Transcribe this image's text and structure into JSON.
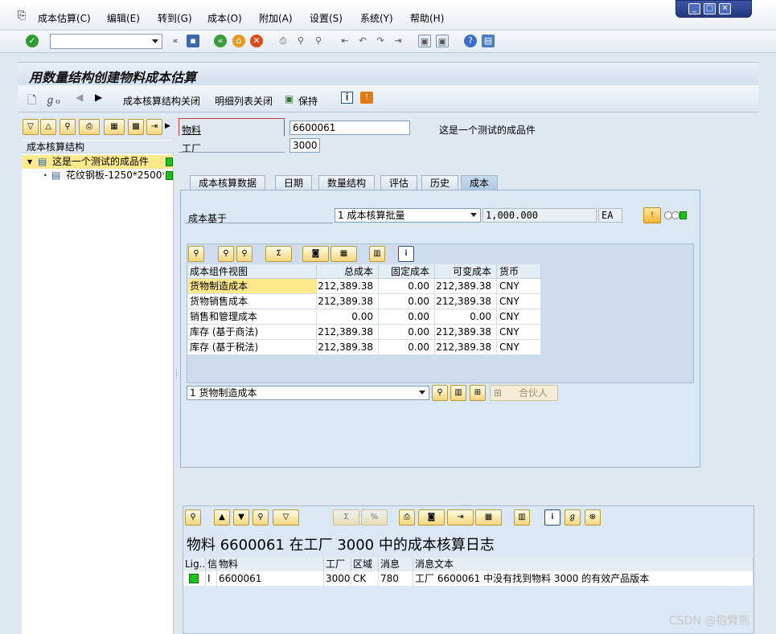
{
  "menu": [
    "成本估算(C)",
    "编辑(E)",
    "转到(G)",
    "成本(O)",
    "附加(A)",
    "设置(S)",
    "系统(Y)",
    "帮助(H)"
  ],
  "title": "用数量结构创建物料成本估算",
  "app_toolbar": {
    "btn1": "成本核算结构关闭",
    "btn2": "明细列表关闭",
    "btn3": "保持"
  },
  "tree": {
    "header": "成本核算结构",
    "root": "这是一个测试的成品件",
    "child": "花纹钢板-1250*2500*"
  },
  "fields": {
    "material_label": "物料",
    "material_value": "6600061",
    "material_desc": "这是一个测试的成品件",
    "plant_label": "工厂",
    "plant_value": "3000"
  },
  "tabs": [
    "成本核算数据",
    "日期",
    "数量结构",
    "评估",
    "历史",
    "成本"
  ],
  "cost_basis": {
    "label": "成本基于",
    "select": "1 成本核算批量",
    "qty": "1,000.000",
    "unit": "EA"
  },
  "grid": {
    "headers": [
      "成本组件视图",
      "总成本",
      "固定成本",
      "可变成本",
      "货币"
    ],
    "rows": [
      [
        "货物制造成本",
        "212,389.38",
        "0.00",
        "212,389.38",
        "CNY"
      ],
      [
        "货物销售成本",
        "212,389.38",
        "0.00",
        "212,389.38",
        "CNY"
      ],
      [
        "销售和管理成本",
        "0.00",
        "0.00",
        "0.00",
        "CNY"
      ],
      [
        "库存 (基于商法)",
        "212,389.38",
        "0.00",
        "212,389.38",
        "CNY"
      ],
      [
        "库存 (基于税法)",
        "212,389.38",
        "0.00",
        "212,389.38",
        "CNY"
      ]
    ]
  },
  "bottom_select": "1 货物制造成本",
  "partner_button": "合伙人",
  "log": {
    "title": "物料 6600061 在工厂 3000 中的成本核算日志",
    "headers": [
      "Lig...",
      "信",
      "物料",
      "工厂",
      "区域",
      "消息",
      "消息文本"
    ],
    "row": [
      "",
      "I",
      "6600061",
      "3000",
      "CK",
      "780",
      "工厂 6600061 中没有找到物料 3000 的有效产品版本"
    ]
  },
  "watermark": "CSDN @抱臂熊",
  "colors": {
    "green_light": "#19c319",
    "selection": "#ffe98a"
  }
}
